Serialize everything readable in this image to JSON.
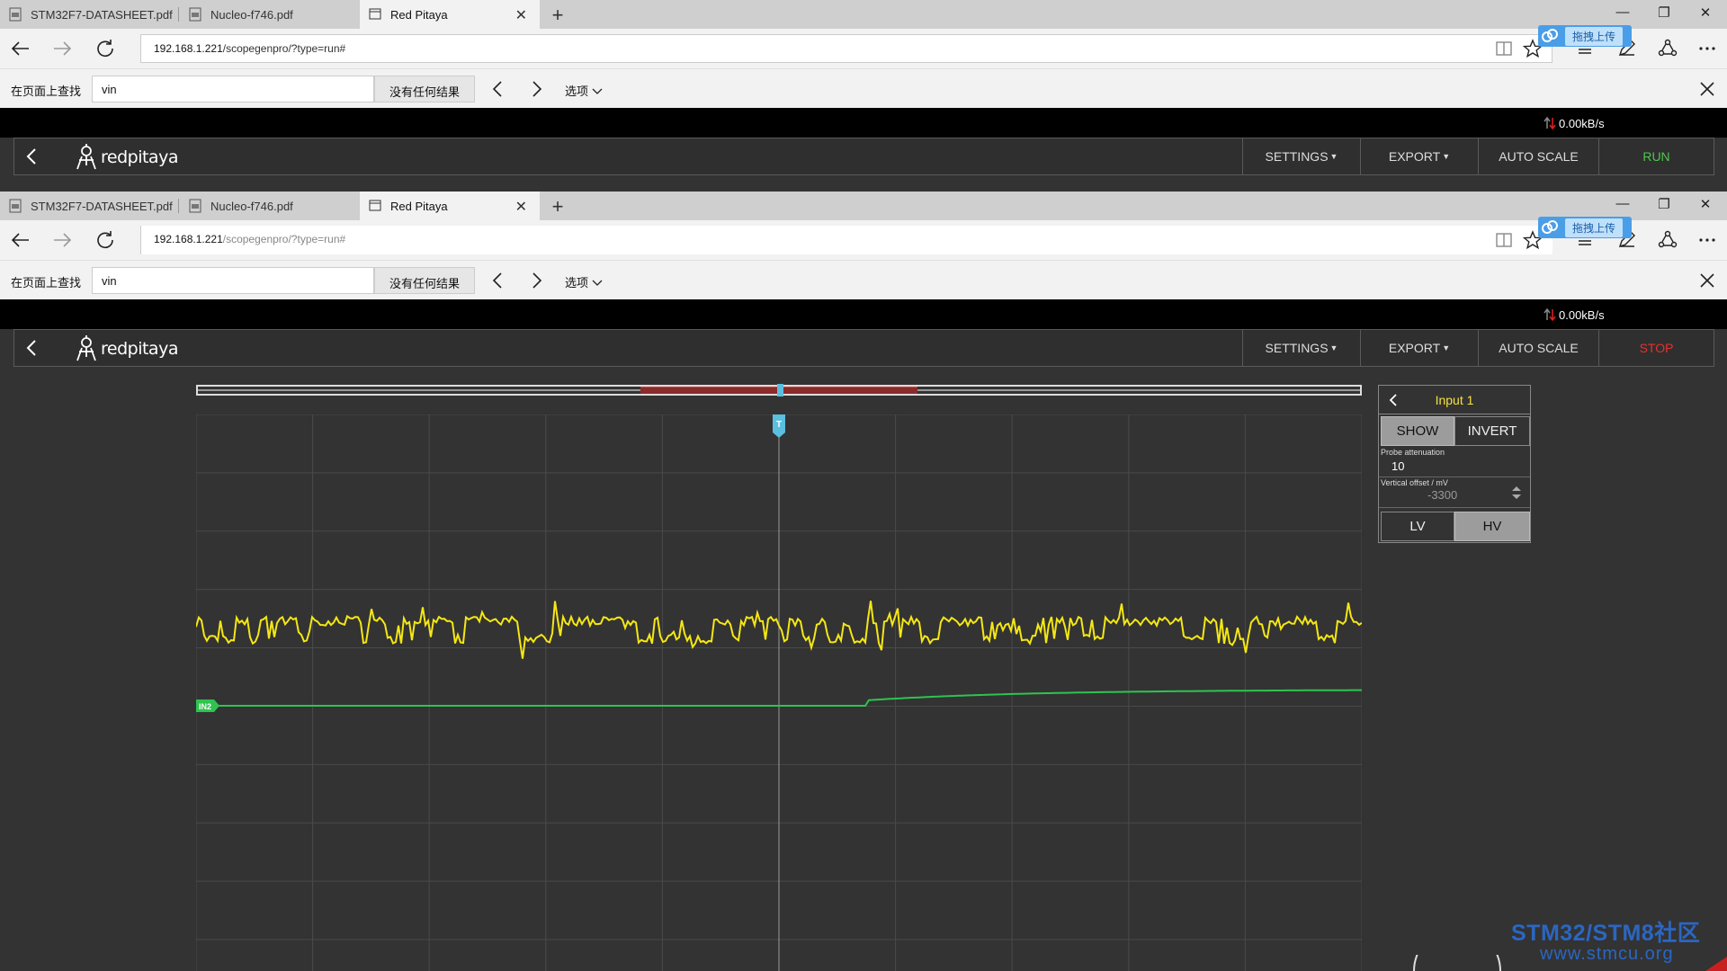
{
  "browser": {
    "tabs": [
      {
        "label": "STM32F7-DATASHEET.pdf",
        "active": false
      },
      {
        "label": "Nucleo-f746.pdf",
        "active": false
      },
      {
        "label": "Red Pitaya",
        "active": true
      }
    ],
    "url_host": "192.168.1.221",
    "url_path": "/scopegenpro/?type=run#",
    "upload_badge": "拖拽上传",
    "find": {
      "label": "在页面上查找",
      "value": "vin",
      "result": "没有任何结果",
      "options": "选项"
    },
    "speed": "0.00kB/s"
  },
  "app": {
    "logo_text": "redpitaya",
    "menu": {
      "settings": "SETTINGS",
      "export": "EXPORT",
      "autoscale": "AUTO SCALE",
      "run": "RUN",
      "stop": "STOP"
    }
  },
  "channel_panel": {
    "title": "Input 1",
    "show": "SHOW",
    "invert": "INVERT",
    "probe_label": "Probe attenuation",
    "probe_value": "10",
    "offset_label": "Vertical offset / mV",
    "offset_value": "-3300",
    "lv": "LV",
    "hv": "HV"
  },
  "plot": {
    "trigger_marker": "T",
    "in2_marker": "IN2",
    "colors": {
      "in1": "#f5e714",
      "in2": "#2ec44f",
      "trigger": "#5bbfe0",
      "grid": "#4a4a4a"
    }
  },
  "watermark": {
    "line1": "STM32/STM8社区",
    "line2": "www.stmcu.org"
  }
}
